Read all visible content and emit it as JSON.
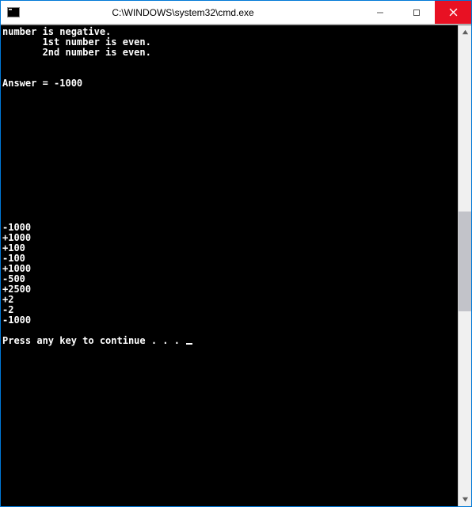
{
  "titlebar": {
    "title": "C:\\WINDOWS\\system32\\cmd.exe"
  },
  "console": {
    "lines": [
      "number is negative.",
      "       1st number is even.",
      "       2nd number is even.",
      "",
      "",
      "Answer = -1000",
      "",
      "",
      "",
      "",
      "",
      "",
      "",
      "",
      "",
      "",
      "",
      "",
      "",
      "-1000",
      "+1000",
      "+100",
      "-100",
      "+1000",
      "-500",
      "+2500",
      "+2",
      "-2",
      "-1000",
      ""
    ],
    "prompt": "Press any key to continue . . . "
  }
}
